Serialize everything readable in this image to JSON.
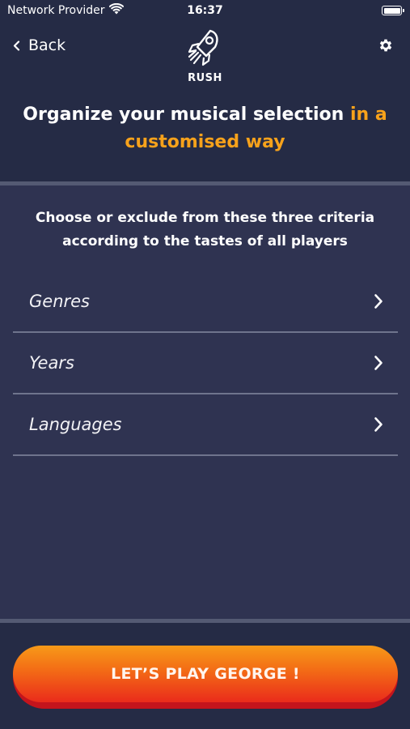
{
  "status_bar": {
    "carrier": "Network Provider",
    "time": "16:37",
    "wifi_icon": "wifi-icon",
    "battery_icon": "battery-icon"
  },
  "header": {
    "back_label": "Back",
    "mode_label": "RUSH",
    "mode_icon": "rocket-icon",
    "settings_icon": "gear-icon",
    "headline_main": "Organize your musical selection ",
    "headline_accent": "in a customised way"
  },
  "content": {
    "instruction": "Choose or exclude from these three criteria according to the tastes of all players",
    "criteria": [
      {
        "label": "Genres"
      },
      {
        "label": "Years"
      },
      {
        "label": "Languages"
      }
    ]
  },
  "footer": {
    "play_button_label": "LET’S PLAY GEORGE !"
  },
  "colors": {
    "background": "#252b45",
    "panel": "#2f3351",
    "accent": "#f7a21b",
    "button_top": "#f79a18",
    "button_bottom": "#ea2b1b"
  }
}
